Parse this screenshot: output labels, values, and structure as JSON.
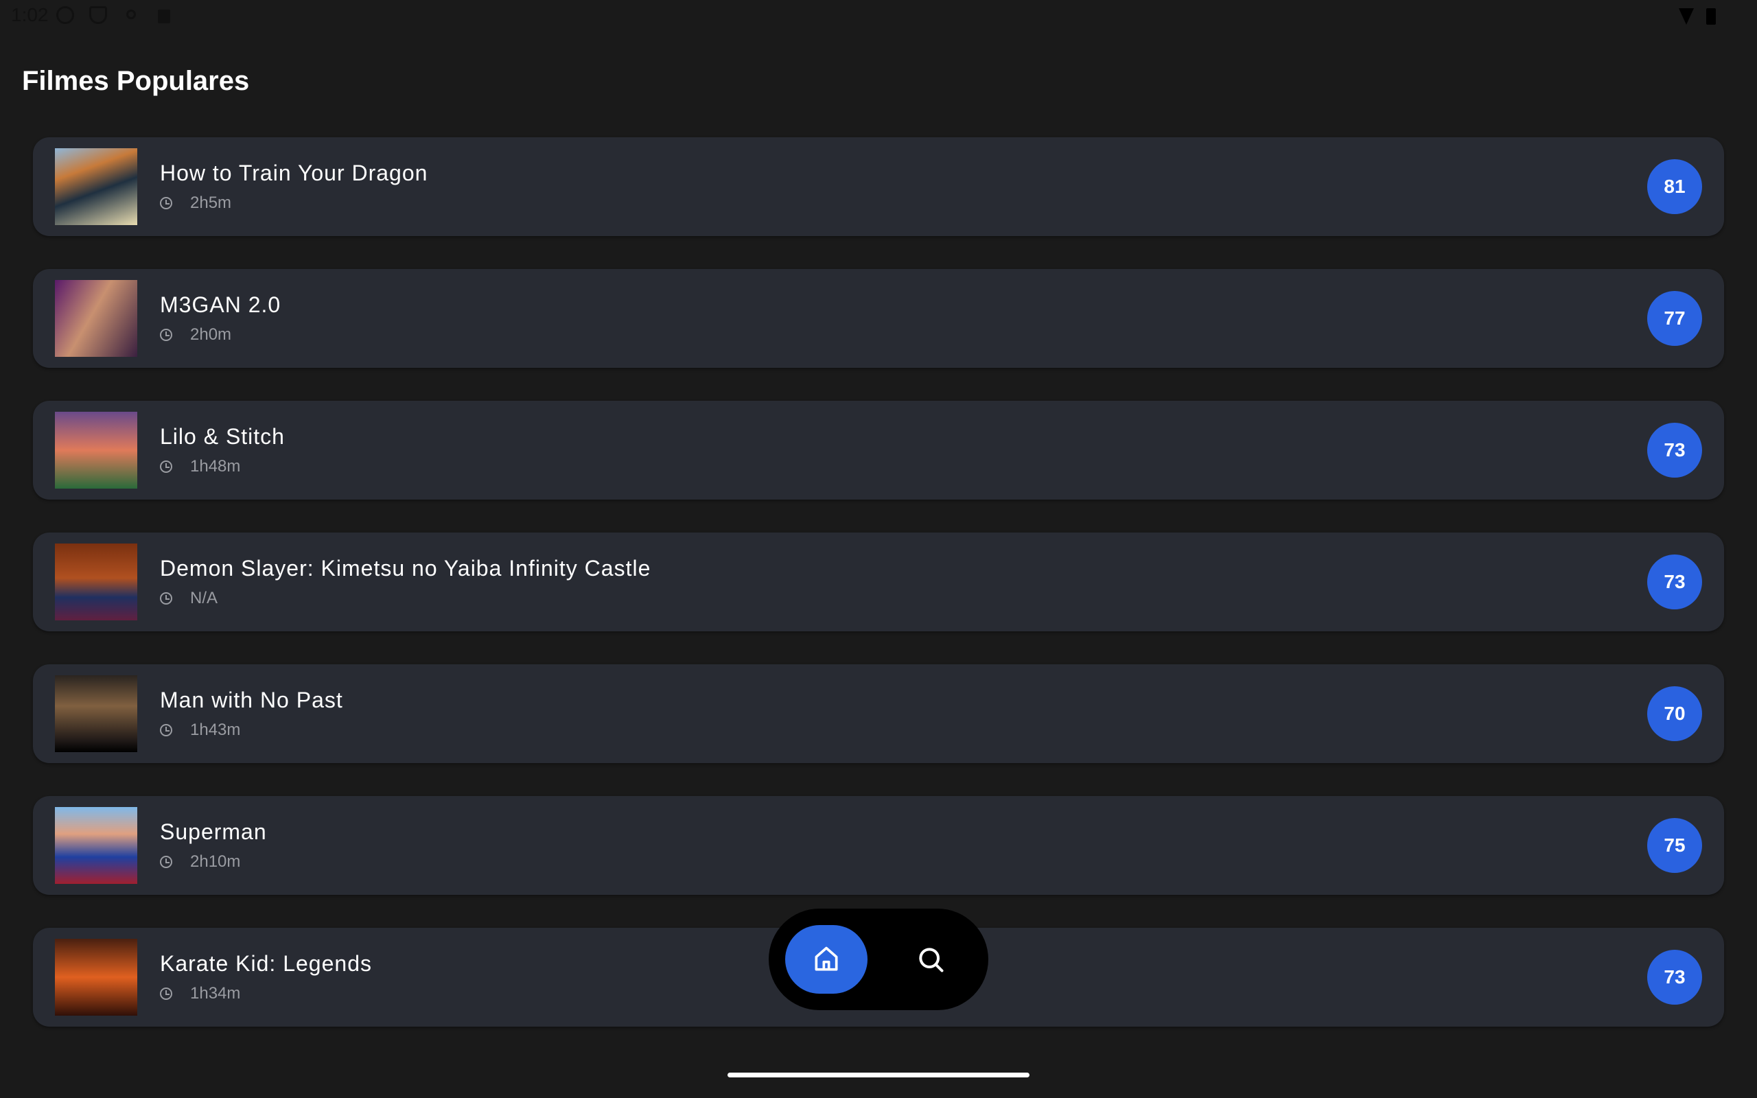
{
  "status_bar": {
    "time": "1:02"
  },
  "page_title": "Filmes Populares",
  "movies": [
    {
      "title": "How to Train Your Dragon",
      "duration": "2h5m",
      "score": "81",
      "thumb": "linear-gradient(160deg,#8fb6d8 0%,#c77a3a 30%,#1f3040 55%,#e8dcb0 100%)"
    },
    {
      "title": "M3GAN 2.0",
      "duration": "2h0m",
      "score": "77",
      "thumb": "linear-gradient(120deg,#5a1a6a 0%,#c89070 45%,#3a2040 100%)"
    },
    {
      "title": "Lilo & Stitch",
      "duration": "1h48m",
      "score": "73",
      "thumb": "linear-gradient(180deg,#6a4a8a 0%,#e07a5a 50%,#2a6a3a 100%)"
    },
    {
      "title": "Demon Slayer: Kimetsu no Yaiba Infinity Castle",
      "duration": "N/A",
      "score": "73",
      "thumb": "linear-gradient(180deg,#7a3010 0%,#b05020 45%,#203060 70%,#602040 100%)"
    },
    {
      "title": "Man with No Past",
      "duration": "1h43m",
      "score": "70",
      "thumb": "linear-gradient(180deg,#2a2420 0%,#806040 40%,#201a18 85%,#000 100%)"
    },
    {
      "title": "Superman",
      "duration": "2h10m",
      "score": "75",
      "thumb": "linear-gradient(180deg,#80b8e8 0%,#e0a080 35%,#2040a0 65%,#a02030 100%)"
    },
    {
      "title": "Karate Kid: Legends",
      "duration": "1h34m",
      "score": "73",
      "thumb": "linear-gradient(180deg,#4a2010 0%,#e06020 50%,#301008 100%)"
    }
  ],
  "nav": {
    "items": [
      {
        "icon": "home-icon",
        "active": true
      },
      {
        "icon": "search-icon",
        "active": false
      }
    ]
  },
  "colors": {
    "background": "#1a1a1a",
    "card": "#282b33",
    "accent": "#2a62e0"
  }
}
